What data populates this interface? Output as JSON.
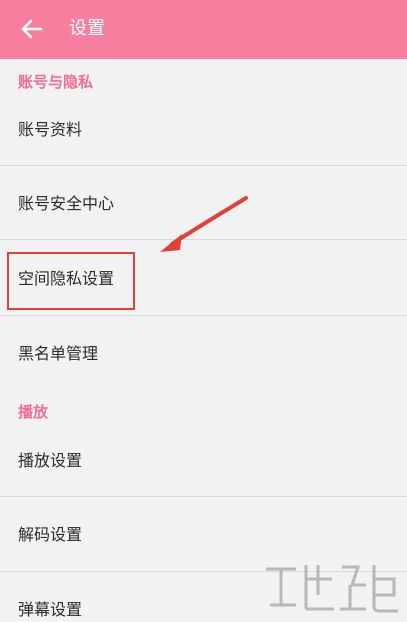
{
  "appbar": {
    "title": "设置",
    "back_icon": "arrow-left-icon",
    "background_color": "#f57f9c"
  },
  "sections": [
    {
      "header": "账号与隐私",
      "items": [
        "账号资料",
        "账号安全中心",
        "空间隐私设置",
        "黑名单管理"
      ]
    },
    {
      "header": "播放",
      "items": [
        "播放设置",
        "解码设置",
        "弹幕设置"
      ]
    }
  ],
  "annotation": {
    "highlighted_item": "空间隐私设置",
    "highlight_color": "#e2403a"
  },
  "accent_color": "#ee6f92"
}
